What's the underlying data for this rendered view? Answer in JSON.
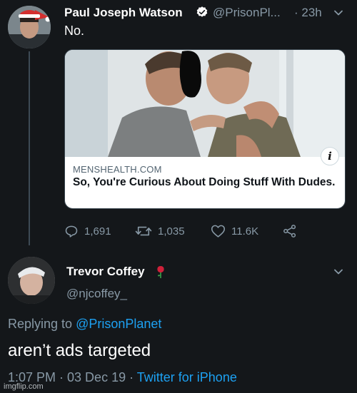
{
  "tweet_main": {
    "author_name": "Paul Joseph Watson",
    "handle": "@PrisonPl...",
    "time": "· 23h",
    "text": "No.",
    "card": {
      "domain": "MENSHEALTH.COM",
      "title": "So, You're Curious About Doing Stuff With Dudes."
    },
    "stats": {
      "replies": "1,691",
      "retweets": "1,035",
      "likes": "11.6K"
    }
  },
  "tweet_reply": {
    "author_name": "Trevor Coffey",
    "handle": "@njcoffey_",
    "replying_prefix": "Replying to",
    "replying_to": "@PrisonPlanet",
    "text": "aren’t ads targeted",
    "date": "1:07 PM · 03 Dec 19 ·",
    "source": "Twitter for iPhone"
  },
  "watermark": "imgflip.com",
  "colors": {
    "background": "#14171a",
    "secondary_text": "#8899a6",
    "link": "#1da1f2",
    "card_border": "#38444d"
  }
}
